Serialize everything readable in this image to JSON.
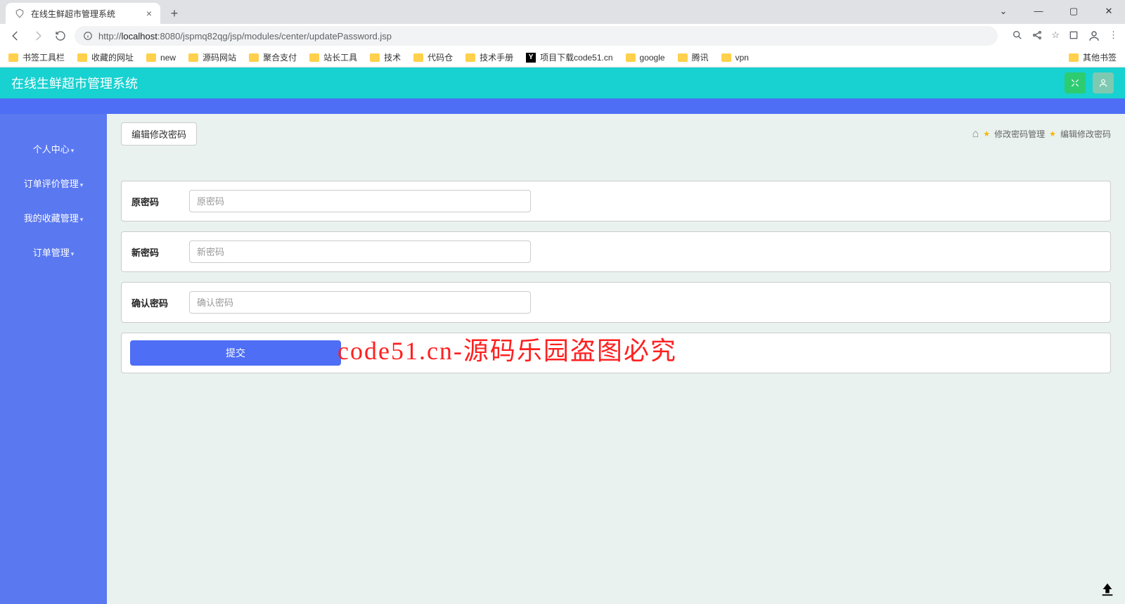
{
  "browser": {
    "tab_title": "在线生鲜超市管理系统",
    "url_prefix": "http://",
    "url_host": "localhost",
    "url_port_path": ":8080/jspmq82qg/jsp/modules/center/updatePassword.jsp",
    "bookmarks": [
      "书签工具栏",
      "收藏的网址",
      "new",
      "源码网站",
      "聚合支付",
      "站长工具",
      "技术",
      "代码仓",
      "技术手册",
      "项目下载code51.cn",
      "google",
      "腾讯",
      "vpn"
    ],
    "other_bookmarks": "其他书签"
  },
  "app": {
    "title": "在线生鲜超市管理系统"
  },
  "sidebar": {
    "items": [
      "个人中心",
      "订单评价管理",
      "我的收藏管理",
      "订单管理"
    ]
  },
  "page": {
    "title_button": "编辑修改密码",
    "breadcrumb": [
      "修改密码管理",
      "编辑修改密码"
    ]
  },
  "form": {
    "original": {
      "label": "原密码",
      "placeholder": "原密码"
    },
    "new": {
      "label": "新密码",
      "placeholder": "新密码"
    },
    "confirm": {
      "label": "确认密码",
      "placeholder": "确认密码"
    },
    "submit": "提交"
  },
  "watermark": "code51.cn-源码乐园盗图必究"
}
